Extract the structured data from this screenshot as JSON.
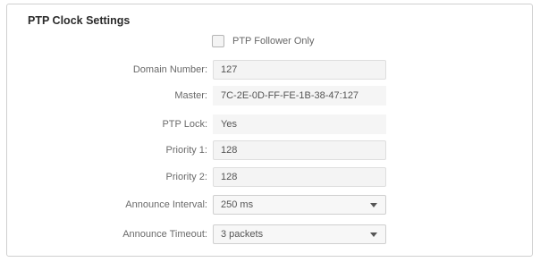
{
  "section": {
    "title": "PTP Clock Settings"
  },
  "follower_only": {
    "label": "PTP Follower Only",
    "checked": false
  },
  "fields": {
    "domain_number": {
      "label": "Domain Number:",
      "value": "127"
    },
    "master": {
      "label": "Master:",
      "value": "7C-2E-0D-FF-FE-1B-38-47:127"
    },
    "ptp_lock": {
      "label": "PTP Lock:",
      "value": "Yes"
    },
    "priority_1": {
      "label": "Priority 1:",
      "value": "128"
    },
    "priority_2": {
      "label": "Priority 2:",
      "value": "128"
    },
    "announce_interval": {
      "label": "Announce Interval:",
      "value": "250 ms"
    },
    "announce_timeout": {
      "label": "Announce Timeout:",
      "value": "3 packets"
    }
  },
  "icons": {
    "select_arrow": "chevron-down-icon"
  }
}
